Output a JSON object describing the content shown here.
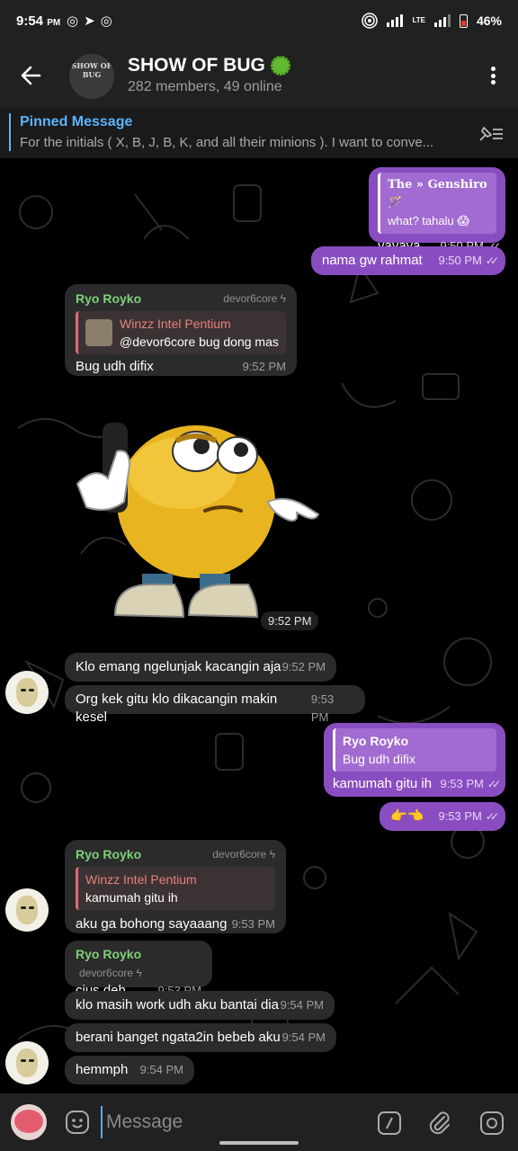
{
  "status_bar": {
    "time": "9:54",
    "ampm": "PM",
    "app_icons": "◎➤◎",
    "network": "LTE",
    "battery": "46%"
  },
  "header": {
    "title": "SHOW OF BUG",
    "subtitle": "282 members, 49 online",
    "avatar_text": "SHOW OF BUG"
  },
  "pinned": {
    "label": "Pinned Message",
    "text": "For the initials ( X, B, J, B, K, and all their minions ). I want to conve..."
  },
  "messages": {
    "m1": {
      "reply_name": "𝐓𝐡𝐞 » 𝐆𝐞𝐧𝐬𝐡𝐢𝐫𝐨 🪄",
      "reply_text": "what? tahalu 😱",
      "text": "yayaya",
      "time": "9:50 PM"
    },
    "m2": {
      "text": "nama gw rahmat",
      "time": "9:50 PM"
    },
    "m3": {
      "sender": "Ryo Royko",
      "via": "devor6core ϟ",
      "reply_name": "Winzz Intel Pentium",
      "reply_text": "@devor6core bug dong mas",
      "text": "Bug udh difix",
      "time": "9:52 PM"
    },
    "sticker": {
      "time": "9:52 PM"
    },
    "m4": {
      "text": "Klo emang ngelunjak kacangin aja",
      "time": "9:52 PM"
    },
    "m5": {
      "text": "Org kek gitu klo dikacangin makin kesel",
      "time": "9:53 PM"
    },
    "m6": {
      "reply_name": "Ryo Royko",
      "reply_text": "Bug udh difix",
      "text": "kamumah gitu ih",
      "time": "9:53 PM"
    },
    "m7": {
      "text": "👉👈",
      "time": "9:53 PM"
    },
    "m8": {
      "sender": "Ryo Royko",
      "via": "devor6core ϟ",
      "reply_name": "Winzz Intel Pentium",
      "reply_text": "kamumah gitu ih",
      "text": "aku ga bohong sayaaang",
      "time": "9:53 PM"
    },
    "m9": {
      "sender": "Ryo Royko",
      "via": "devor6core ϟ",
      "text": "cius deh",
      "time": "9:53 PM"
    },
    "m10": {
      "text": "klo masih work udh aku bantai dia",
      "time": "9:54 PM"
    },
    "m11": {
      "text": "berani banget ngata2in bebeb aku",
      "time": "9:54 PM"
    },
    "m12": {
      "text": "hemmph",
      "time": "9:54 PM"
    }
  },
  "input": {
    "placeholder": "Message"
  },
  "colors": {
    "bar_bg": "#212121",
    "outgoing_bubble": "#8a4dc1",
    "incoming_bubble": "#2b2b2b",
    "accent_blue": "#5cb3ff",
    "sender_green": "#7ed07a",
    "reply_red": "#e8807c"
  }
}
